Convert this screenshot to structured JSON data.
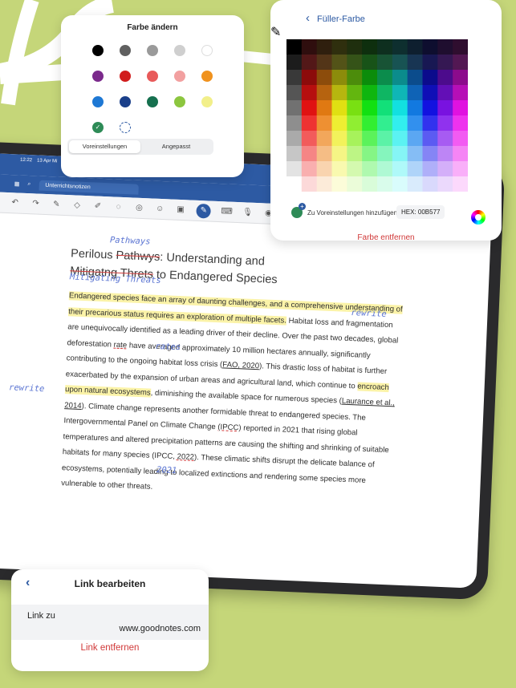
{
  "colors": {
    "background": "#c5d679",
    "accent": "#2d5aa3",
    "danger": "#d03838",
    "highlight": "#fbf3a8"
  },
  "farbe_card": {
    "title": "Farbe ändern",
    "segments": [
      "Voreinstellungen",
      "Angepasst"
    ],
    "selected_segment": "Voreinstellungen",
    "swatches": [
      "#000000",
      "#606060",
      "#9a9a9a",
      "#cfcfcf",
      "#ffffff",
      "#7b2a8c",
      "#d11d1d",
      "#e85a5a",
      "#f2a0a0",
      "#f0921e",
      "#1e78d4",
      "#1a3f8a",
      "#16704f",
      "#8cc63f",
      "#f2ef8a"
    ]
  },
  "fueller_card": {
    "back_label": "Füller-Farbe",
    "add_preset_label": "Zu Voreinstellungen hinzufügen",
    "hex_label": "HEX: 00B577",
    "remove_label": "Farbe entfernen"
  },
  "ipad": {
    "status_time": "12:22",
    "status_date": "13 Apr Mi",
    "notebook_name": "Unterrichtsnotizen"
  },
  "document": {
    "title_prefix": "Perilous ",
    "title_struck": "Pathwys",
    "title_rest": ": Understanding and",
    "title_line2_struck": "Mitigatng Threts",
    "title_line2_rest": " to Endangered Species",
    "hand_pathways": "Pathways",
    "hand_mitigating": "Mitigating Threats",
    "hand_rewrite_1": "rewrite",
    "hand_rates": "rates",
    "hand_rewrite_2": "rewrite",
    "hand_2021": "2021",
    "p1_hl": "Endangered species face an array of daunting challenges, and a comprehensive understanding of their precarious status requires an exploration of multiple facets.",
    "p1_a": " Habitat loss and fragmentation are unequivocally identified as a leading driver of their decline. Over the past two decades, global deforestation ",
    "p1_rate": "rate",
    "p1_b": " have averaged approximately 10 million hectares annually, significantly contributing to the ongoing habitat loss crisis (",
    "p1_fao": "FAO, 2020",
    "p1_c": "). This drastic loss of habitat is further exacerbated by the expansion of urban areas and agricultural land, which continue to ",
    "p1_hl2": "encroach upon natural ecosystems",
    "p1_d": ", diminishing the available space for numerous species (",
    "p1_laurance": "Laurance et al., 2014",
    "p1_e": "). Climate change represents another formidable threat to endangered species. The Intergovernmental Panel on Climate Change ",
    "p1_ipcc": "(IPCC)",
    "p1_f": " reported in 2021 that rising global temperatures and altered precipitation patterns are causing the shifting and shrinking of suitable habitats for many species (",
    "p1_ipcc2": "IPCC, ",
    "p1_2022": "2022",
    "p1_g": "). These climatic shifts disrupt the delicate balance of ecosystems, potentially leading to localized extinctions and rendering some species more vulnerable to other threats."
  },
  "link_card": {
    "title": "Link bearbeiten",
    "field_label": "Link zu",
    "field_value": "www.goodnotes.com",
    "remove_label": "Link entfernen"
  }
}
